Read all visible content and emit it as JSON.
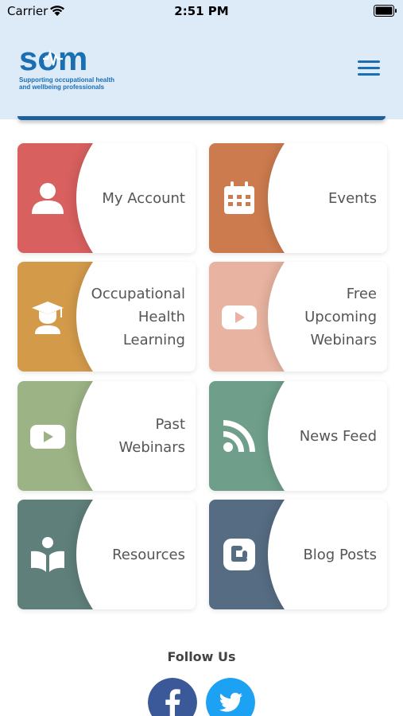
{
  "status_bar": {
    "carrier": "Carrier",
    "time": "2:51 PM"
  },
  "header": {
    "logo_word": "som",
    "logo_tagline_line1": "Supporting occupational health",
    "logo_tagline_line2": "and wellbeing professionals",
    "menu_icon": "hamburger-icon"
  },
  "tiles": [
    {
      "label": "My Account",
      "color": "#d8605f",
      "icon": "user-icon"
    },
    {
      "label": "Events",
      "color": "#cc7b4e",
      "icon": "calendar-icon"
    },
    {
      "label": "Occupational\nHealth\nLearning",
      "color": "#d39a4a",
      "icon": "graduate-icon"
    },
    {
      "label": "Free\nUpcoming\nWebinars",
      "color": "#e8b3a0",
      "icon": "youtube-icon"
    },
    {
      "label": "Past\nWebinars",
      "color": "#9cb385",
      "icon": "youtube-icon"
    },
    {
      "label": "News Feed",
      "color": "#6f9f8a",
      "icon": "rss-icon"
    },
    {
      "label": "Resources",
      "color": "#5f7f7a",
      "icon": "book-reader-icon"
    },
    {
      "label": "Blog Posts",
      "color": "#566c82",
      "icon": "blogger-icon"
    }
  ],
  "footer": {
    "follow_label": "Follow Us",
    "social": [
      {
        "icon": "facebook-icon",
        "color": "#3b5998"
      },
      {
        "icon": "twitter-icon",
        "color": "#1da1f2"
      }
    ]
  }
}
